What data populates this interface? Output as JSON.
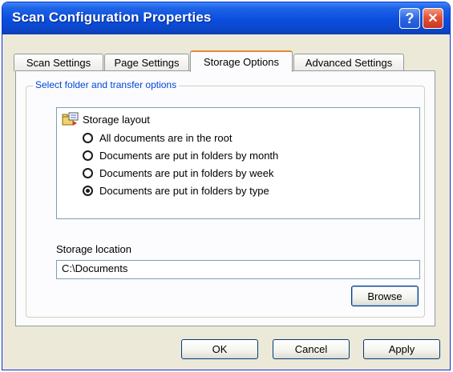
{
  "window": {
    "title": "Scan Configuration Properties",
    "help_label": "?",
    "close_label": "✕"
  },
  "tabs": [
    {
      "label": "Scan Settings",
      "active": false
    },
    {
      "label": "Page Settings",
      "active": false
    },
    {
      "label": "Storage Options",
      "active": true
    },
    {
      "label": "Advanced Settings",
      "active": false
    }
  ],
  "group": {
    "legend": "Select folder and transfer options"
  },
  "storage_layout": {
    "title": "Storage layout",
    "icon": "folder-scan-icon",
    "options": [
      {
        "label": "All documents are in the root",
        "checked": false
      },
      {
        "label": "Documents are put in folders by month",
        "checked": false
      },
      {
        "label": "Documents are put in folders by week",
        "checked": false
      },
      {
        "label": "Documents are put in folders by type",
        "checked": true
      }
    ]
  },
  "storage_location": {
    "label": "Storage location",
    "value": "C:\\Documents",
    "browse_label": "Browse"
  },
  "footer": {
    "ok_label": "OK",
    "cancel_label": "Cancel",
    "apply_label": "Apply"
  },
  "colors": {
    "titlebar": "#0a4ddf",
    "accent_tab": "#e68b2c",
    "legend_text": "#0046d5",
    "dialog_bg": "#ece9d8"
  }
}
